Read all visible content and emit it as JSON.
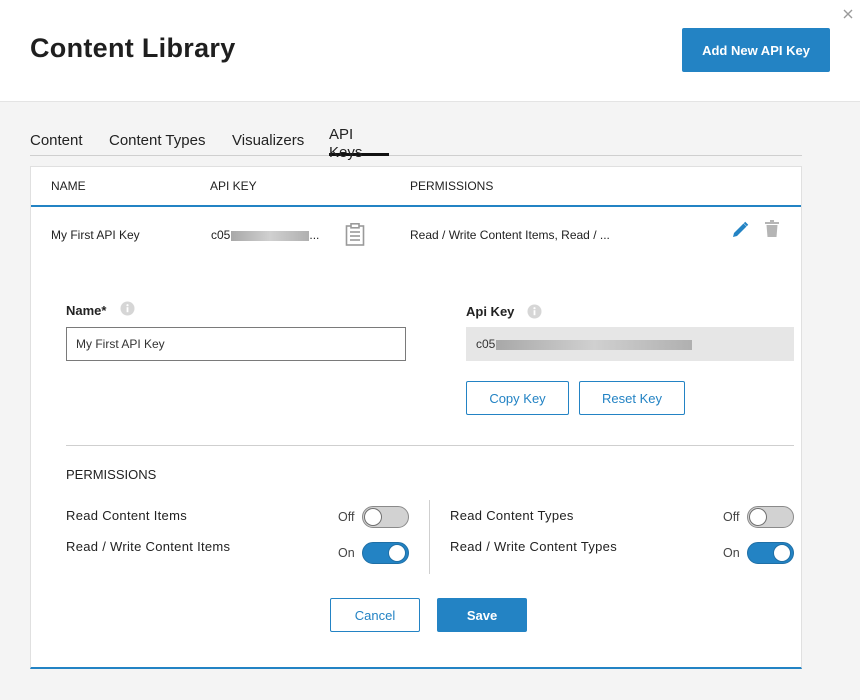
{
  "header": {
    "title": "Content Library",
    "add_button_label": "Add New API Key"
  },
  "tabs": [
    {
      "label": "Content"
    },
    {
      "label": "Content Types"
    },
    {
      "label": "Visualizers"
    },
    {
      "label": "API Keys",
      "active": true
    }
  ],
  "table": {
    "columns": [
      "NAME",
      "API KEY",
      "PERMISSIONS"
    ],
    "row": {
      "name": "My First API Key",
      "api_key_prefix": "c05",
      "api_key_suffix": "...",
      "permissions": "Read / Write Content Items, Read / ..."
    }
  },
  "form": {
    "name_label": "Name*",
    "name_value": "My First API Key",
    "api_key_label": "Api Key",
    "api_key_prefix": "c05",
    "copy_label": "Copy Key",
    "reset_label": "Reset Key",
    "permissions_heading": "PERMISSIONS",
    "permissions": [
      {
        "label": "Read Content Items",
        "state": "Off",
        "on": false
      },
      {
        "label": "Read / Write Content Items",
        "state": "On",
        "on": true
      },
      {
        "label": "Read Content Types",
        "state": "Off",
        "on": false
      },
      {
        "label": "Read / Write Content Types",
        "state": "On",
        "on": true
      }
    ],
    "cancel_label": "Cancel",
    "save_label": "Save"
  },
  "colors": {
    "accent": "#2383c4",
    "toggle_off": "#d2d2d2"
  },
  "icons": [
    "close-icon",
    "clipboard-icon",
    "edit-pencil-icon",
    "trash-icon",
    "info-icon"
  ]
}
